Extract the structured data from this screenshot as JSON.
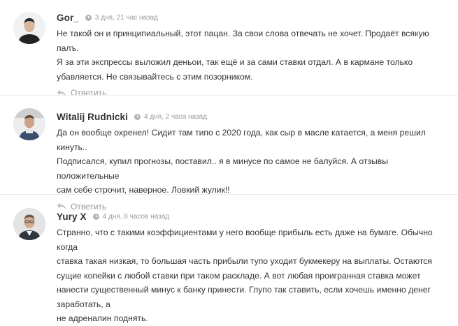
{
  "comments": [
    {
      "author": "Gor_",
      "date": "3 дня, 21 час назад",
      "lines": [
        "Не такой он и принципиальный, этот пацан. За свои слова отвечать не хочет. Продаёт всякую палъ.",
        "Я за эти экспрессы выложил деньои, так ещё и за сами ставки отдал. А в кармане только",
        "убавляется. Не связывайтесь с этим позорником."
      ],
      "reply": "Ответить"
    },
    {
      "author": "Witalij Rudnicki",
      "date": "4 дня, 2 часа назад",
      "lines": [
        "Да он вообще охренел! Сидит там типо с 2020 года, как сыр в масле катается, а меня решил кинуть..",
        "Подписался, купил прогнозы, поставил.. я в минусе по самое не балуйся. А отзывы положительные",
        "сам себе строчит, наверное. Ловкий жулик!!"
      ],
      "reply": "Ответить"
    },
    {
      "author": "Yury X",
      "date": "4 дня, 8 часов назад",
      "lines": [
        "Странно, что с такими коэффициентами у него вообще прибыль есть даже на бумаге. Обычно когда",
        "ставка такая низкая, то большая часть прибыли тупо уходит букмекеру на выплаты. Остаются",
        "сущие копейки с любой ставки при таком раскладе. А вот любая проигранная ставка может",
        "нанести существенный минус к банку принести. Глупо так ставить, если хочешь именно денег заработать, а",
        "не адреналин поднять."
      ]
    }
  ],
  "icons": {
    "clock": "clock-icon",
    "reply": "reply-arrow-icon"
  },
  "colors": {
    "text": "#333333",
    "meta": "#999999",
    "divider": "#ececec"
  }
}
